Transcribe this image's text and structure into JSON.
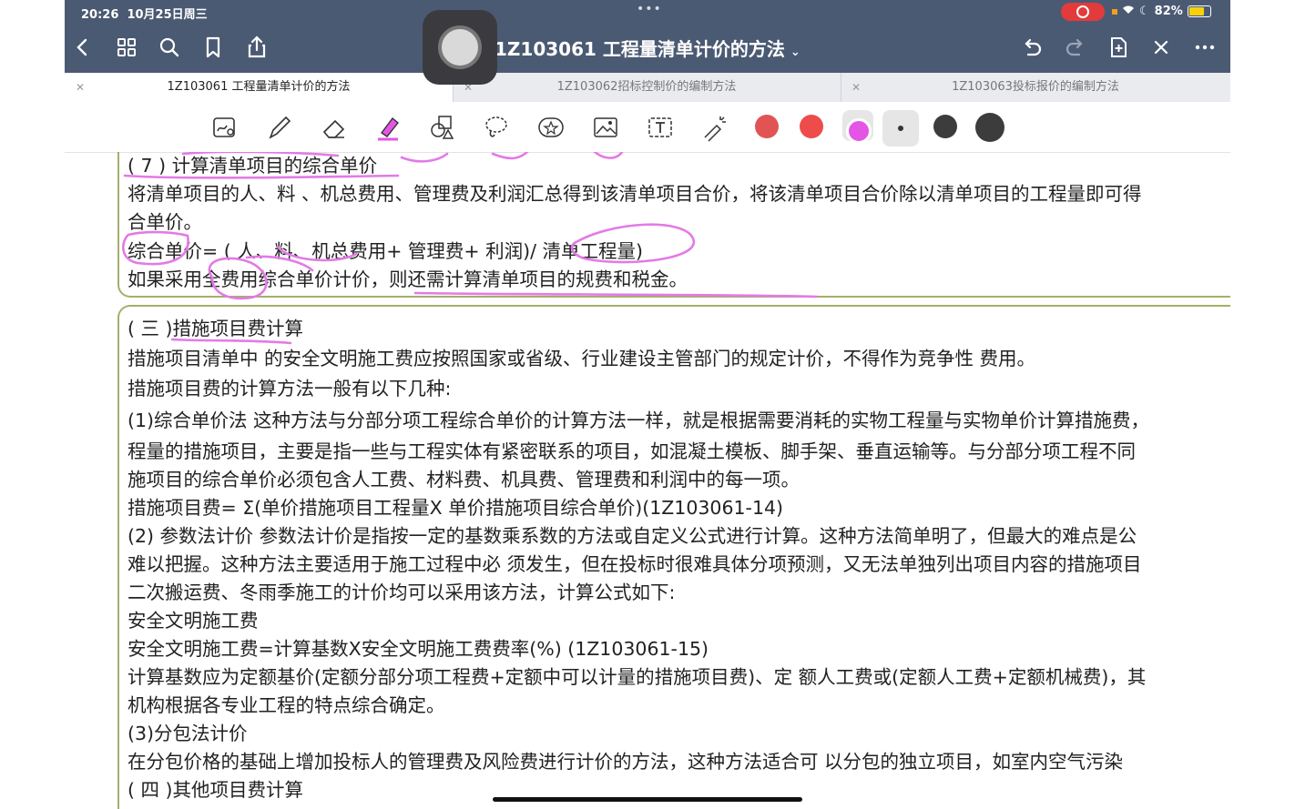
{
  "status_bar": {
    "time": "20:26",
    "date": "10月25日周三",
    "battery": "82%"
  },
  "header": {
    "title": "1Z103061 工程量清单计价的方法",
    "chevron": "⌄"
  },
  "tabs": [
    {
      "label": "1Z103061 工程量清单计价的方法"
    },
    {
      "label": "1Z103062招标控制价的编制方法"
    },
    {
      "label": "1Z103063投标报价的编制方法"
    }
  ],
  "toolbar_icons": {
    "back": "chevron-left-icon",
    "grid": "grid-icon",
    "search": "search-icon",
    "bookmark": "bookmark-icon",
    "share": "share-icon",
    "undo": "undo-icon",
    "redo": "redo-icon",
    "add_page": "add-page-icon",
    "close": "close-icon",
    "more": "more-icon"
  },
  "tools": [
    "zoom-pen",
    "pen",
    "eraser",
    "highlighter",
    "shapes",
    "lasso",
    "sticker",
    "image",
    "text",
    "laser"
  ],
  "colors": [
    "#e25454",
    "#ee4b4b",
    "#e455e6",
    "#3c3c3c",
    "#3c3c3c"
  ],
  "content": {
    "section1": {
      "heading": "( 7 ) 计算清单项目的综合单价",
      "lines": [
        "将清单项目的人、料 、机总费用、管理费及利润汇总得到该清单项目合价，将该清单项目合价除以清单项目的工程量即可得",
        "合单价。",
        "综合单价= ( 人、料、机总费用+ 管理费+ 利润)/ 清单工程量)",
        "如果采用全费用综合单价计价，则还需计算清单项目的规费和税金。"
      ]
    },
    "section2": {
      "heading": "( 三 )措施项目费计算",
      "lines": [
        "措施项目清单中 的安全文明施工费应按照国家或省级、行业建设主管部门的规定计价，不得作为竞争性 费用。",
        "措施项目费的计算方法一般有以下几种:",
        "(1)综合单价法 这种方法与分部分项工程综合单价的计算方法一样，就是根据需要消耗的实物工程量与实物单价计算措施费，",
        "程量的措施项目，主要是指一些与工程实体有紧密联系的项目，如混凝土模板、脚手架、垂直运输等。与分部分项工程不同",
        "施项目的综合单价必须包含人工费、材料费、机具费、管理费和利润中的每一项。",
        "措施项目费= Σ(单价措施项目工程量X 单价措施项目综合单价)(1Z103061-14)",
        "(2) 参数法计价 参数法计价是指按一定的基数乘系数的方法或自定义公式进行计算。这种方法简单明了，但最大的难点是公",
        "难以把握。这种方法主要适用于施工过程中必 须发生，但在投标时很难具体分项预测，又无法单独列出项目内容的措施项目",
        "二次搬运费、冬雨季施工的计价均可以采用该方法，计算公式如下:",
        "安全文明施工费",
        "安全文明施工费=计算基数X安全文明施工费费率(%) (1Z103061-15)",
        "计算基数应为定额基价(定额分部分项工程费+定额中可以计量的措施项目费)、定 额人工费或(定额人工费+定额机械费)，其",
        "机构根据各专业工程的特点综合确定。",
        "(3)分包法计价",
        "在分包价格的基础上增加投标人的管理费及风险费进行计价的方法，这种方法适合可 以分包的独立项目，如室内空气污染",
        "( 四 )其他项目费计算"
      ]
    }
  }
}
